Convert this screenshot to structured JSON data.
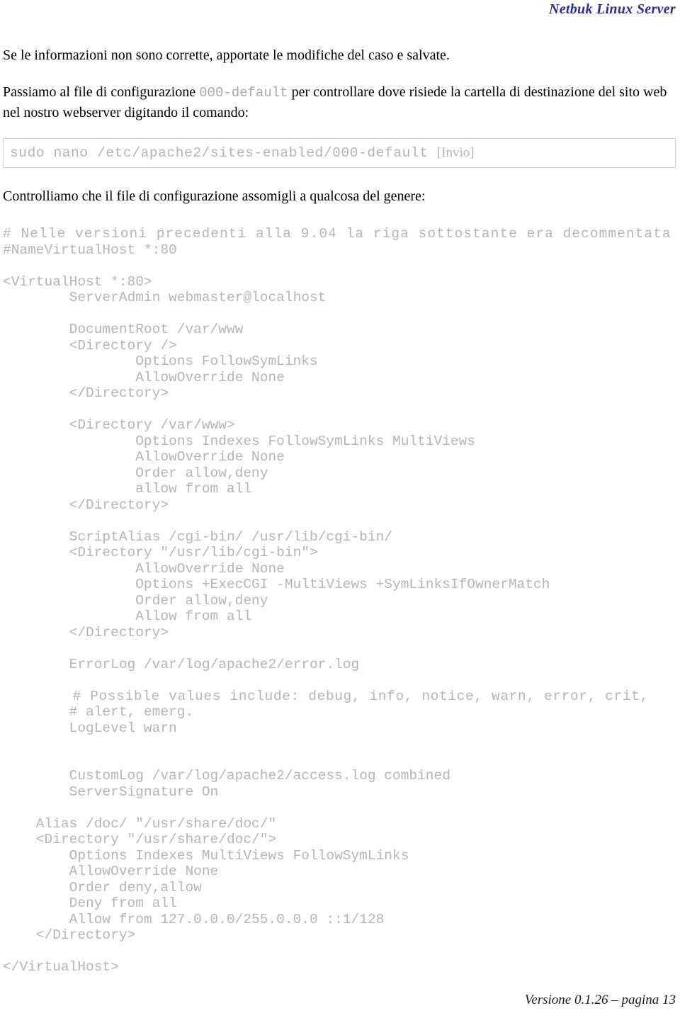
{
  "header": {
    "title": "Netbuk Linux Server"
  },
  "body": {
    "intro_line": "Se le informazioni non sono corrette, apportate le modifiche del caso e salvate.",
    "para2_before": "Passiamo al file di configurazione ",
    "para2_code": "000-default",
    "para2_after": " per controllare dove risiede la cartella di destinazione del sito web nel nostro webserver digitando il comando:",
    "para3": "Controlliamo che il file di configurazione assomigli a qualcosa del genere:"
  },
  "command_box": {
    "command": "sudo nano /etc/apache2/sites-enabled/000-default ",
    "key_hint": "[Invio]"
  },
  "config_listing": {
    "lines": [
      "# Nelle versioni precedenti alla 9.04 la riga sottostante era decommentata",
      "#NameVirtualHost *:80",
      "",
      "<VirtualHost *:80>",
      "        ServerAdmin webmaster@localhost",
      "",
      "        DocumentRoot /var/www",
      "        <Directory />",
      "                Options FollowSymLinks",
      "                AllowOverride None",
      "        </Directory>",
      "",
      "        <Directory /var/www>",
      "                Options Indexes FollowSymLinks MultiViews",
      "                AllowOverride None",
      "                Order allow,deny",
      "                allow from all",
      "        </Directory>",
      "",
      "        ScriptAlias /cgi-bin/ /usr/lib/cgi-bin/",
      "        <Directory \"/usr/lib/cgi-bin\">",
      "                AllowOverride None",
      "                Options +ExecCGI -MultiViews +SymLinksIfOwnerMatch",
      "                Order allow,deny",
      "                Allow from all",
      "        </Directory>",
      "",
      "        ErrorLog /var/log/apache2/error.log",
      "",
      "        # Possible values include: debug, info, notice, warn, error, crit,",
      "        # alert, emerg.",
      "        LogLevel warn",
      "",
      "",
      "        CustomLog /var/log/apache2/access.log combined",
      "        ServerSignature On",
      "",
      "    Alias /doc/ \"/usr/share/doc/\"",
      "    <Directory \"/usr/share/doc/\">",
      "        Options Indexes MultiViews FollowSymLinks",
      "        AllowOverride None",
      "        Order deny,allow",
      "        Deny from all",
      "        Allow from 127.0.0.0/255.0.0.0 ::1/128",
      "    </Directory>",
      "",
      "</VirtualHost>"
    ]
  },
  "footer": {
    "text": "Versione 0.1.26 – pagina 13"
  }
}
